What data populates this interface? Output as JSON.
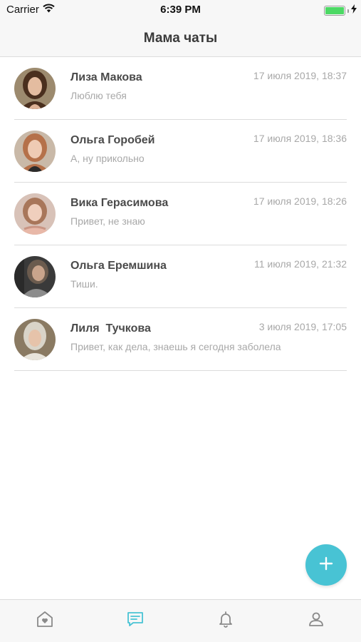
{
  "status_bar": {
    "carrier": "Carrier",
    "time": "6:39 PM",
    "wifi_icon": "wifi-icon",
    "battery_icon": "battery-icon",
    "charging_icon": "bolt-icon"
  },
  "nav": {
    "title": "Мама чаты"
  },
  "chats": [
    {
      "name": "Лиза Макова",
      "message": "Люблю тебя",
      "time": "17 июля 2019, 18:37"
    },
    {
      "name": "Ольга Горобей",
      "message": "А, ну прикольно",
      "time": "17 июля 2019, 18:36"
    },
    {
      "name": "Вика Герасимова",
      "message": "Привет, не знаю",
      "time": "17 июля 2019, 18:26"
    },
    {
      "name": "Ольга Еремшина",
      "message": "Тиши.",
      "time": "11 июля 2019, 21:32"
    },
    {
      "name": "Лиля  Тучкова",
      "message": "Привет, как дела, знаешь я сегодня заболела",
      "time": "3 июля 2019, 17:05"
    }
  ],
  "fab": {
    "icon": "plus-icon"
  },
  "tabs": [
    {
      "icon": "home-heart-icon",
      "active": false
    },
    {
      "icon": "chat-icon",
      "active": true
    },
    {
      "icon": "bell-icon",
      "active": false
    },
    {
      "icon": "profile-icon",
      "active": false
    }
  ],
  "colors": {
    "accent": "#48c3d4",
    "inactive_icon": "#8a8a8a",
    "battery": "#4cd964"
  }
}
